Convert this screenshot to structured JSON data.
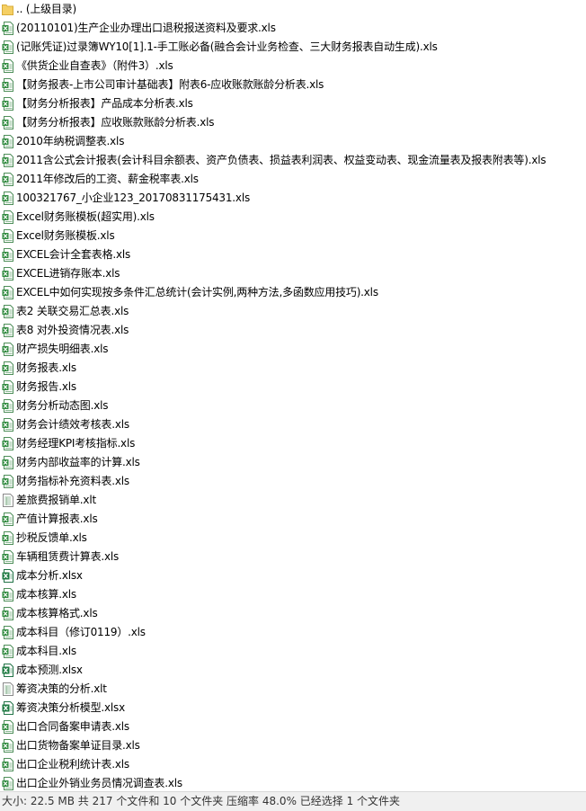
{
  "file_list": {
    "items": [
      {
        "name": ".. (上级目录)",
        "icon": "folder-icon"
      },
      {
        "name": "(20110101)生产企业办理出口退税报送资料及要求.xls",
        "icon": "xls-file-icon"
      },
      {
        "name": "(记账凭证)过录簿WY10[1].1-手工账必备(融合会计业务检查、三大财务报表自动生成).xls",
        "icon": "xls-file-icon"
      },
      {
        "name": "《供货企业自查表》（附件3）.xls",
        "icon": "xls-file-icon"
      },
      {
        "name": "【财务报表-上市公司审计基础表】附表6-应收账款账龄分析表.xls",
        "icon": "xls-file-icon"
      },
      {
        "name": "【财务分析报表】产品成本分析表.xls",
        "icon": "xls-file-icon"
      },
      {
        "name": "【财务分析报表】应收账款账龄分析表.xls",
        "icon": "xls-file-icon"
      },
      {
        "name": "2010年纳税调整表.xls",
        "icon": "xls-file-icon"
      },
      {
        "name": "2011含公式会计报表(会计科目余额表、资产负债表、损益表利润表、权益变动表、现金流量表及报表附表等).xls",
        "icon": "xls-file-icon"
      },
      {
        "name": "2011年修改后的工资、薪金税率表.xls",
        "icon": "xls-file-icon"
      },
      {
        "name": "100321767_小企业123_20170831175431.xls",
        "icon": "xls-file-icon"
      },
      {
        "name": "Excel财务账模板(超实用).xls",
        "icon": "xls-file-icon"
      },
      {
        "name": "Excel财务账模板.xls",
        "icon": "xls-file-icon"
      },
      {
        "name": "EXCEL会计全套表格.xls",
        "icon": "xls-file-icon"
      },
      {
        "name": "EXCEL进销存账本.xls",
        "icon": "xls-file-icon"
      },
      {
        "name": "EXCEL中如何实现按多条件汇总统计(会计实例,两种方法,多函数应用技巧).xls",
        "icon": "xls-file-icon"
      },
      {
        "name": "表2 关联交易汇总表.xls",
        "icon": "xls-file-icon"
      },
      {
        "name": "表8 对外投资情况表.xls",
        "icon": "xls-file-icon"
      },
      {
        "name": "财产损失明细表.xls",
        "icon": "xls-file-icon"
      },
      {
        "name": "财务报表.xls",
        "icon": "xls-file-icon"
      },
      {
        "name": "财务报告.xls",
        "icon": "xls-file-icon"
      },
      {
        "name": "财务分析动态图.xls",
        "icon": "xls-file-icon"
      },
      {
        "name": "财务会计绩效考核表.xls",
        "icon": "xls-file-icon"
      },
      {
        "name": "财务经理KPI考核指标.xls",
        "icon": "xls-file-icon"
      },
      {
        "name": "财务内部收益率的计算.xls",
        "icon": "xls-file-icon"
      },
      {
        "name": "财务指标补充资料表.xls",
        "icon": "xls-file-icon"
      },
      {
        "name": "差旅费报销单.xlt",
        "icon": "xlt-file-icon"
      },
      {
        "name": "产值计算报表.xls",
        "icon": "xls-file-icon"
      },
      {
        "name": "抄税反馈单.xls",
        "icon": "xls-file-icon"
      },
      {
        "name": "车辆租赁费计算表.xls",
        "icon": "xls-file-icon"
      },
      {
        "name": "成本分析.xlsx",
        "icon": "xlsx-file-icon"
      },
      {
        "name": "成本核算.xls",
        "icon": "xls-file-icon"
      },
      {
        "name": "成本核算格式.xls",
        "icon": "xls-file-icon"
      },
      {
        "name": "成本科目（修订0119）.xls",
        "icon": "xls-file-icon"
      },
      {
        "name": "成本科目.xls",
        "icon": "xls-file-icon"
      },
      {
        "name": "成本预测.xlsx",
        "icon": "xlsx-file-icon"
      },
      {
        "name": "筹资决策的分析.xlt",
        "icon": "xlt-file-icon"
      },
      {
        "name": "筹资决策分析模型.xlsx",
        "icon": "xlsx-file-icon"
      },
      {
        "name": "出口合同备案申请表.xls",
        "icon": "xls-file-icon"
      },
      {
        "name": "出口货物备案单证目录.xls",
        "icon": "xls-file-icon"
      },
      {
        "name": "出口企业税利统计表.xls",
        "icon": "xls-file-icon"
      },
      {
        "name": "出口企业外销业务员情况调查表.xls",
        "icon": "xls-file-icon"
      }
    ]
  },
  "status_bar": {
    "text": "大小: 22.5 MB 共 217 个文件和 10 个文件夹 压缩率 48.0% 已经选择 1 个文件夹"
  }
}
